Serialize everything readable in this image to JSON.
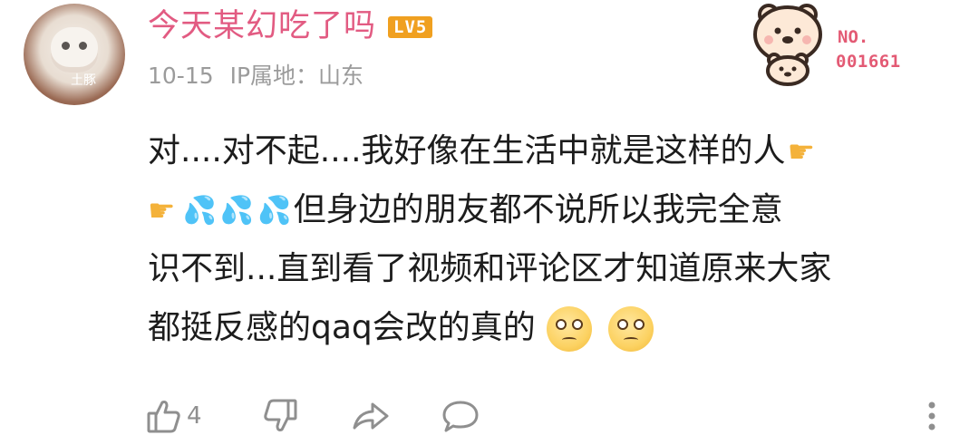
{
  "comment": {
    "username": "今天某幻吃了吗",
    "level": "LV5",
    "date": "10-15",
    "ip_location": "IP属地：山东",
    "avatar_text": "土豚",
    "fan_number_label": "NO.",
    "fan_number": "001661",
    "text_lines": {
      "line1": "对....对不起....我好像在生活中就是这样的人",
      "line2": "但身边的朋友都不说所以我完全意",
      "line3": "识不到...直到看了视频和评论区才知道原来大家",
      "line4": "都挺反感的qaq会改的真的"
    },
    "likes": "4"
  },
  "icons": {
    "avatar": "cat-avatar",
    "decoration": "bear-decoration-icon",
    "point_right": "backhand-index-pointing-right-icon",
    "sweat": "sweat-droplets-icon",
    "pleading": "pleading-face-icon",
    "like": "thumbs-up-icon",
    "dislike": "thumbs-down-icon",
    "share": "share-arrow-icon",
    "reply": "comment-bubble-icon",
    "more": "more-vertical-icon"
  },
  "colors": {
    "username": "#e25b82",
    "level_badge": "#f0a020",
    "meta": "#9b9b9b",
    "text": "#1c1c1c",
    "fan_number": "#e35a74",
    "icons": "#8f8f8f"
  }
}
